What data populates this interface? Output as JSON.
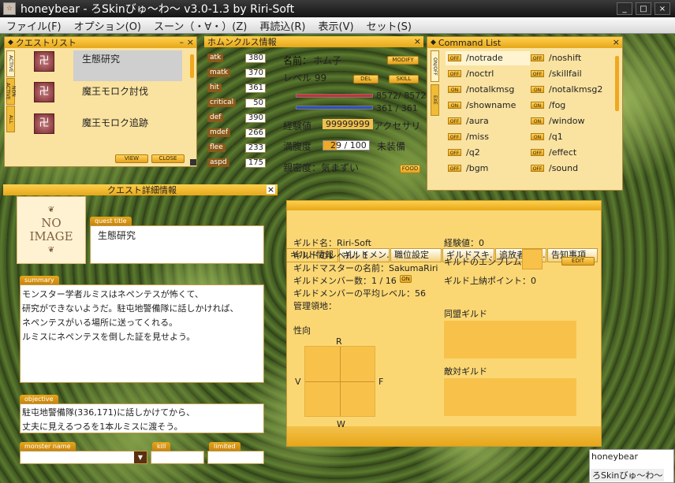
{
  "window": {
    "title": "honeybear - ろSkinびゅ～わ～ v3.0-1.3 by Riri-Soft",
    "min": "_",
    "max": "□",
    "close": "×"
  },
  "menu": [
    "ファイル(F)",
    "オプション(O)",
    "スーン（・∀・）(Z)",
    "再読込(R)",
    "表示(V)",
    "セット(S)"
  ],
  "quest_list": {
    "title": "クエストリスト",
    "tabs": [
      "ACTIVE",
      "NON ACTIVE",
      "ALL"
    ],
    "items": [
      "生態研究",
      "魔王モロク討伐",
      "魔王モロク追跡"
    ],
    "view": "VIEW",
    "close": "CLOSE"
  },
  "homun": {
    "title": "ホムンクルス情報",
    "stats": [
      {
        "k": "atk",
        "v": "380"
      },
      {
        "k": "matk",
        "v": "370"
      },
      {
        "k": "hit",
        "v": "361"
      },
      {
        "k": "critical",
        "v": "50"
      },
      {
        "k": "def",
        "v": "390"
      },
      {
        "k": "mdef",
        "v": "266"
      },
      {
        "k": "flee",
        "v": "233"
      },
      {
        "k": "aspd",
        "v": "175"
      }
    ],
    "name_label": "名前：",
    "name": "ホム子",
    "level": "レベル 99",
    "hp": "8572/ 8572",
    "sp": "361 / 361",
    "exp_label": "経験値",
    "exp": "99999999",
    "acc": "アクセサリ",
    "hunger_label": "満腹度",
    "hunger": "29 / 100",
    "equip": "未装備",
    "affection": "親密度：気まずい",
    "hunger_pct": 29,
    "buttons": {
      "modify": "MODIFY",
      "del": "DEL",
      "skill": "SKILL",
      "food": "FOOD"
    }
  },
  "cmd": {
    "title": "Command List",
    "tabs": [
      "ON/OFF",
      "EXE"
    ],
    "left": [
      {
        "t": "OFF",
        "n": "/notrade"
      },
      {
        "t": "OFF",
        "n": "/noctrl"
      },
      {
        "t": "ON",
        "n": "/notalkmsg"
      },
      {
        "t": "ON",
        "n": "/showname"
      },
      {
        "t": "OFF",
        "n": "/aura"
      },
      {
        "t": "OFF",
        "n": "/miss"
      },
      {
        "t": "OFF",
        "n": "/q2"
      },
      {
        "t": "OFF",
        "n": "/bgm"
      }
    ],
    "right": [
      {
        "t": "OFF",
        "n": "/noshift"
      },
      {
        "t": "OFF",
        "n": "/skillfail"
      },
      {
        "t": "ON",
        "n": "/notalkmsg2"
      },
      {
        "t": "ON",
        "n": "/fog"
      },
      {
        "t": "ON",
        "n": "/window"
      },
      {
        "t": "ON",
        "n": "/q1"
      },
      {
        "t": "OFF",
        "n": "/effect"
      },
      {
        "t": "OFF",
        "n": "/sound"
      }
    ]
  },
  "qd": {
    "title": "クエスト詳細情報",
    "noimg1": "NO",
    "noimg2": "IMAGE",
    "title_tag": "quest title",
    "qtitle": "生態研究",
    "summary_tag": "summary",
    "summary": [
      "モンスター学者ルミスはネペンテスが怖くて、",
      "研究ができないようだ。駐屯地警備隊に話しかければ、",
      "ネペンテスがいる場所に送ってくれる。",
      "ルミスにネペンテスを倒した証を見せよう。"
    ],
    "objective_tag": "objective",
    "objective": [
      "駐屯地警備隊(336,171)に話しかけてから、",
      "丈夫に見えるつるを1本ルミスに渡そう。"
    ],
    "monster_tag": "monster name",
    "kill_tag": "kill",
    "limited_tag": "limited"
  },
  "guild": {
    "tabs": [
      "ギルド情報",
      "ギルドメン…",
      "職位設定",
      "ギルドスキ…",
      "追放者リス…",
      "告知事項"
    ],
    "name": "ギルド名：Riri-Soft",
    "level": "ギルドのレベル：1",
    "master": "ギルドマスターの名前：SakumaRiri",
    "members": "ギルドメンバー数：1 / 16",
    "avg": "ギルドメンバーの平均レベル：56",
    "territory": "管理領地：",
    "exp": "経験値：0",
    "emblem": "ギルドのエンブレム",
    "points": "ギルド上納ポイント：0",
    "edit": "EDIT",
    "on": "ON",
    "tendency": "性向",
    "R": "R",
    "V": "V",
    "F": "F",
    "W": "W",
    "alliance": "同盟ギルド",
    "enemy": "敵対ギルド"
  },
  "chatbox": {
    "name": "honeybear",
    "label": "ろSkinびゅ～わ～"
  },
  "colors": {
    "win_bg": "#fae3a0",
    "accent": "#e6a71a"
  }
}
